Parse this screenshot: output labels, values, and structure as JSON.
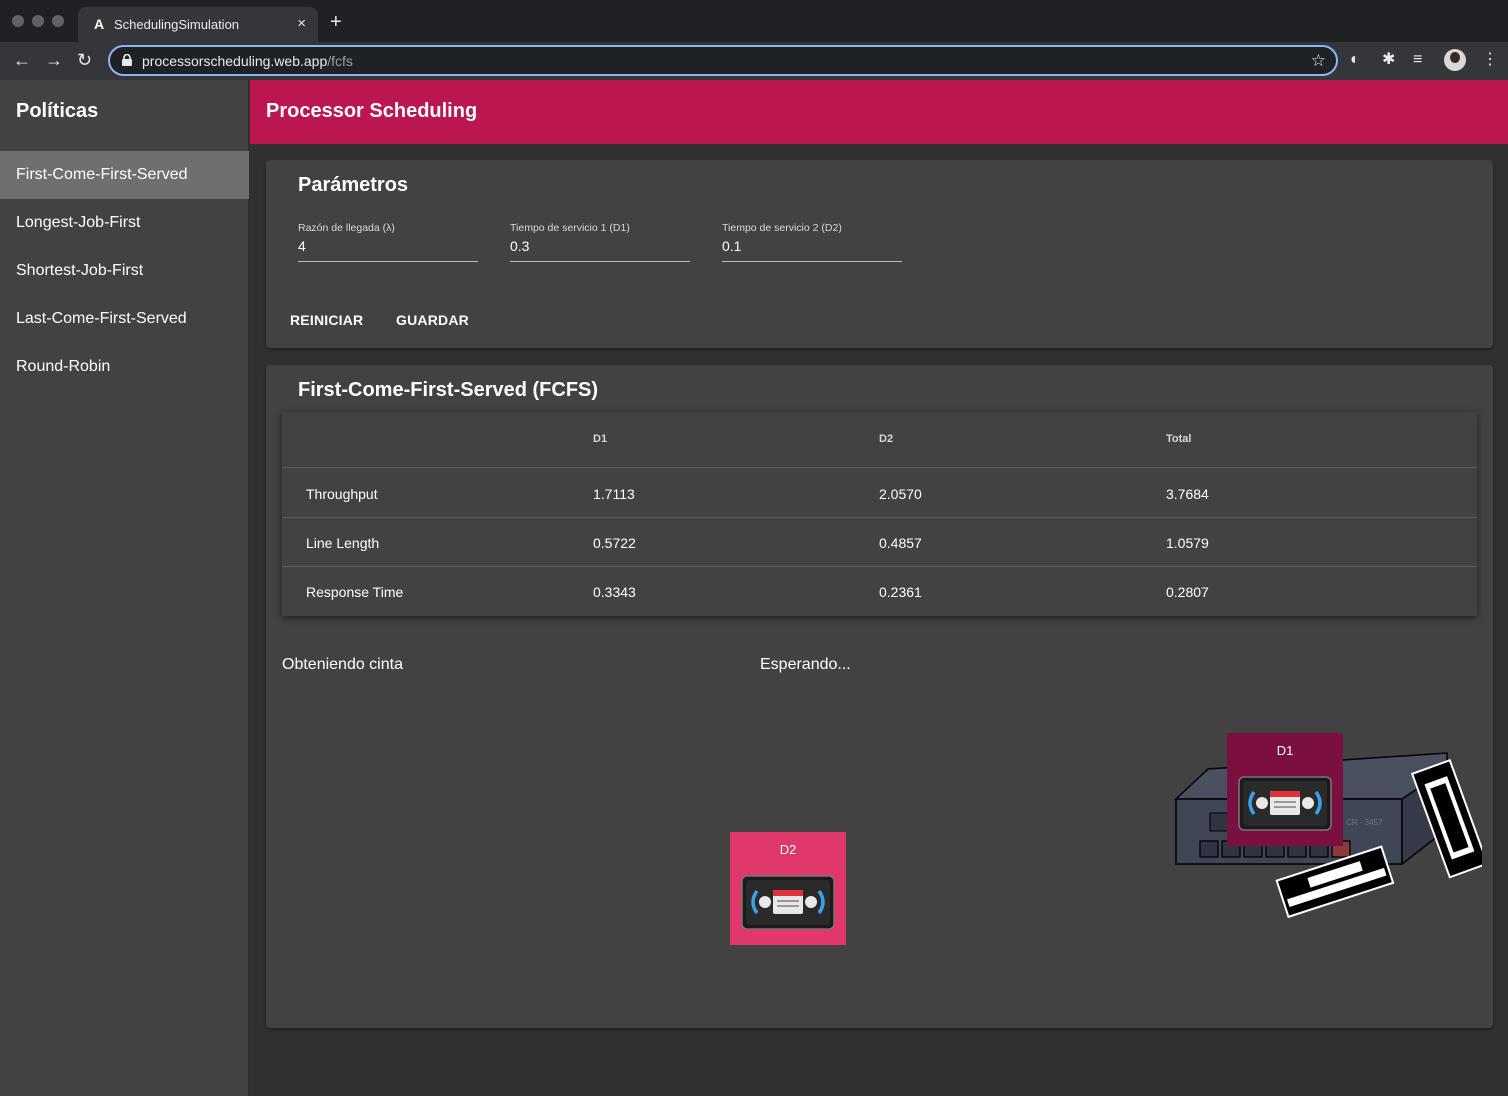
{
  "browser": {
    "tab_title": "SchedulingSimulation",
    "new_tab": "+",
    "tab_close": "×",
    "url_domain": "processorscheduling.web.app",
    "url_path": "/fcfs"
  },
  "sidebar": {
    "title": "Políticas",
    "items": [
      {
        "label": "First-Come-First-Served",
        "active": true
      },
      {
        "label": "Longest-Job-First"
      },
      {
        "label": "Shortest-Job-First"
      },
      {
        "label": "Last-Come-First-Served"
      },
      {
        "label": "Round-Robin"
      }
    ]
  },
  "app": {
    "title": "Processor Scheduling",
    "accent_color": "#bb1650"
  },
  "params": {
    "title": "Parámetros",
    "fields": [
      {
        "label": "Razón de llegada (λ)",
        "value": "4"
      },
      {
        "label": "Tiempo de servicio 1 (D1)",
        "value": "0.3"
      },
      {
        "label": "Tiempo de servicio 2 (D2)",
        "value": "0.1"
      }
    ],
    "reset_label": "REINICIAR",
    "save_label": "GUARDAR"
  },
  "results": {
    "title": "First-Come-First-Served (FCFS)",
    "columns": [
      "",
      "D1",
      "D2",
      "Total"
    ],
    "rows": [
      {
        "metric": "Throughput",
        "d1": "1.7113",
        "d2": "2.0570",
        "total": "3.7684"
      },
      {
        "metric": "Line Length",
        "d1": "0.5722",
        "d2": "0.4857",
        "total": "1.0579"
      },
      {
        "metric": "Response Time",
        "d1": "0.3343",
        "d2": "0.2361",
        "total": "0.2807"
      }
    ]
  },
  "simulation": {
    "status_left": "Obteniendo cinta",
    "status_right": "Esperando...",
    "processors": [
      {
        "label": "D1",
        "color": "#7a1040",
        "icon": "vhs-cassette-icon"
      },
      {
        "label": "D2",
        "color": "#e0386a",
        "icon": "vhs-cassette-icon"
      }
    ],
    "vcr_text": "CR - 3457"
  }
}
